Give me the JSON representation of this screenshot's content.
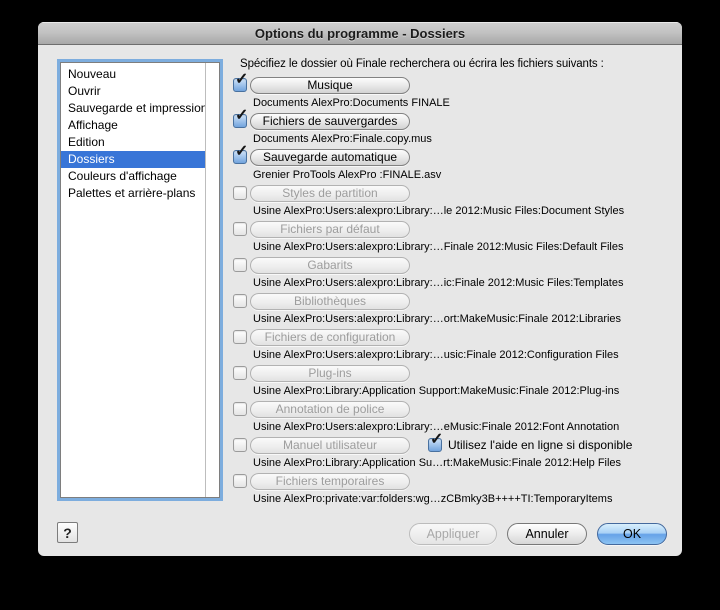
{
  "window": {
    "title": "Options du programme - Dossiers"
  },
  "colors": {
    "selection_blue": "#3875d7",
    "checkbox_blue": "#72a4dd",
    "ok_button_blue": "#66a2e8"
  },
  "sidebar": {
    "items": [
      {
        "label": "Nouveau",
        "selected": false
      },
      {
        "label": "Ouvrir",
        "selected": false
      },
      {
        "label": "Sauvegarde et impression",
        "selected": false
      },
      {
        "label": "Affichage",
        "selected": false
      },
      {
        "label": "Edition",
        "selected": false
      },
      {
        "label": "Dossiers",
        "selected": true
      },
      {
        "label": "Couleurs d'affichage",
        "selected": false
      },
      {
        "label": "Palettes et arrière-plans",
        "selected": false
      }
    ]
  },
  "main": {
    "header": "Spécifiez le dossier où Finale recherchera ou écrira les fichiers suivants :",
    "rows": [
      {
        "checked": true,
        "enabled": true,
        "button": "Musique",
        "path": "Documents AlexPro:Documents FINALE"
      },
      {
        "checked": true,
        "enabled": true,
        "button": "Fichiers de sauvergardes",
        "path": "Documents AlexPro:Finale.copy.mus"
      },
      {
        "checked": true,
        "enabled": true,
        "button": "Sauvegarde automatique",
        "path": "Grenier ProTools AlexPro :FINALE.asv"
      },
      {
        "checked": false,
        "enabled": false,
        "button": "Styles de partition",
        "path": "Usine AlexPro:Users:alexpro:Library:…le 2012:Music Files:Document Styles"
      },
      {
        "checked": false,
        "enabled": false,
        "button": "Fichiers par défaut",
        "path": "Usine AlexPro:Users:alexpro:Library:…Finale 2012:Music Files:Default Files"
      },
      {
        "checked": false,
        "enabled": false,
        "button": "Gabarits",
        "path": "Usine AlexPro:Users:alexpro:Library:…ic:Finale 2012:Music Files:Templates"
      },
      {
        "checked": false,
        "enabled": false,
        "button": "Bibliothèques",
        "path": "Usine AlexPro:Users:alexpro:Library:…ort:MakeMusic:Finale 2012:Libraries"
      },
      {
        "checked": false,
        "enabled": false,
        "button": "Fichiers de configuration",
        "path": "Usine AlexPro:Users:alexpro:Library:…usic:Finale 2012:Configuration Files"
      },
      {
        "checked": false,
        "enabled": false,
        "button": "Plug-ins",
        "path": "Usine AlexPro:Library:Application Support:MakeMusic:Finale 2012:Plug-ins"
      },
      {
        "checked": false,
        "enabled": false,
        "button": "Annotation de police",
        "path": "Usine AlexPro:Users:alexpro:Library:…eMusic:Finale 2012:Font Annotation"
      },
      {
        "checked": false,
        "enabled": false,
        "button": "Manuel utilisateur",
        "path": "Usine AlexPro:Library:Application Su…rt:MakeMusic:Finale 2012:Help Files",
        "inline_checkbox": {
          "checked": true,
          "label": "Utilisez l'aide en ligne si disponible"
        }
      },
      {
        "checked": false,
        "enabled": false,
        "button": "Fichiers temporaires",
        "path": "Usine AlexPro:private:var:folders:wg…zCBmky3B++++TI:TemporaryItems"
      }
    ]
  },
  "footer": {
    "help": "?",
    "apply": "Appliquer",
    "apply_enabled": false,
    "cancel": "Annuler",
    "ok": "OK"
  }
}
